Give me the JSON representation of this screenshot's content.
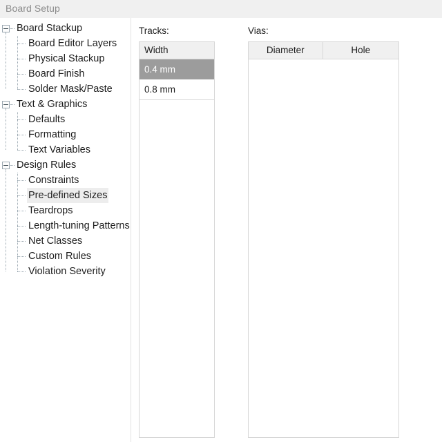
{
  "window": {
    "title": "Board Setup"
  },
  "sidebar": {
    "items": [
      {
        "label": "Board Stackup",
        "level": 0,
        "expander": "minus-box-icon",
        "selected": false
      },
      {
        "label": "Board Editor Layers",
        "level": 1,
        "expander": "none",
        "selected": false
      },
      {
        "label": "Physical Stackup",
        "level": 1,
        "expander": "none",
        "selected": false
      },
      {
        "label": "Board Finish",
        "level": 1,
        "expander": "none",
        "selected": false
      },
      {
        "label": "Solder Mask/Paste",
        "level": 1,
        "expander": "none",
        "selected": false
      },
      {
        "label": "Text & Graphics",
        "level": 0,
        "expander": "minus-box-icon",
        "selected": false
      },
      {
        "label": "Defaults",
        "level": 1,
        "expander": "none",
        "selected": false
      },
      {
        "label": "Formatting",
        "level": 1,
        "expander": "none",
        "selected": false
      },
      {
        "label": "Text Variables",
        "level": 1,
        "expander": "none",
        "selected": false
      },
      {
        "label": "Design Rules",
        "level": 0,
        "expander": "minus-box-icon",
        "selected": false
      },
      {
        "label": "Constraints",
        "level": 1,
        "expander": "none",
        "selected": false
      },
      {
        "label": "Pre-defined Sizes",
        "level": 1,
        "expander": "none",
        "selected": true
      },
      {
        "label": "Teardrops",
        "level": 1,
        "expander": "none",
        "selected": false
      },
      {
        "label": "Length-tuning Patterns",
        "level": 1,
        "expander": "none",
        "selected": false
      },
      {
        "label": "Net Classes",
        "level": 1,
        "expander": "none",
        "selected": false
      },
      {
        "label": "Custom Rules",
        "level": 1,
        "expander": "none",
        "selected": false
      },
      {
        "label": "Violation Severity",
        "level": 1,
        "expander": "none",
        "selected": false
      }
    ]
  },
  "tracks": {
    "caption": "Tracks:",
    "columns": [
      "Width"
    ],
    "rows": [
      {
        "width": "0.4 mm",
        "selected": true
      },
      {
        "width": "0.8 mm",
        "selected": false
      }
    ]
  },
  "vias": {
    "caption": "Vias:",
    "columns": [
      "Diameter",
      "Hole"
    ],
    "rows": []
  },
  "colors": {
    "title_text": "#8a8a8a",
    "titlebar_bg": "#f0f0f0",
    "selection_bg": "#9c9c9c",
    "selection_text": "#ffffff",
    "tree_selection_bg": "#ededed",
    "header_bg": "#f0f0f0",
    "border": "#d6d6d6"
  }
}
